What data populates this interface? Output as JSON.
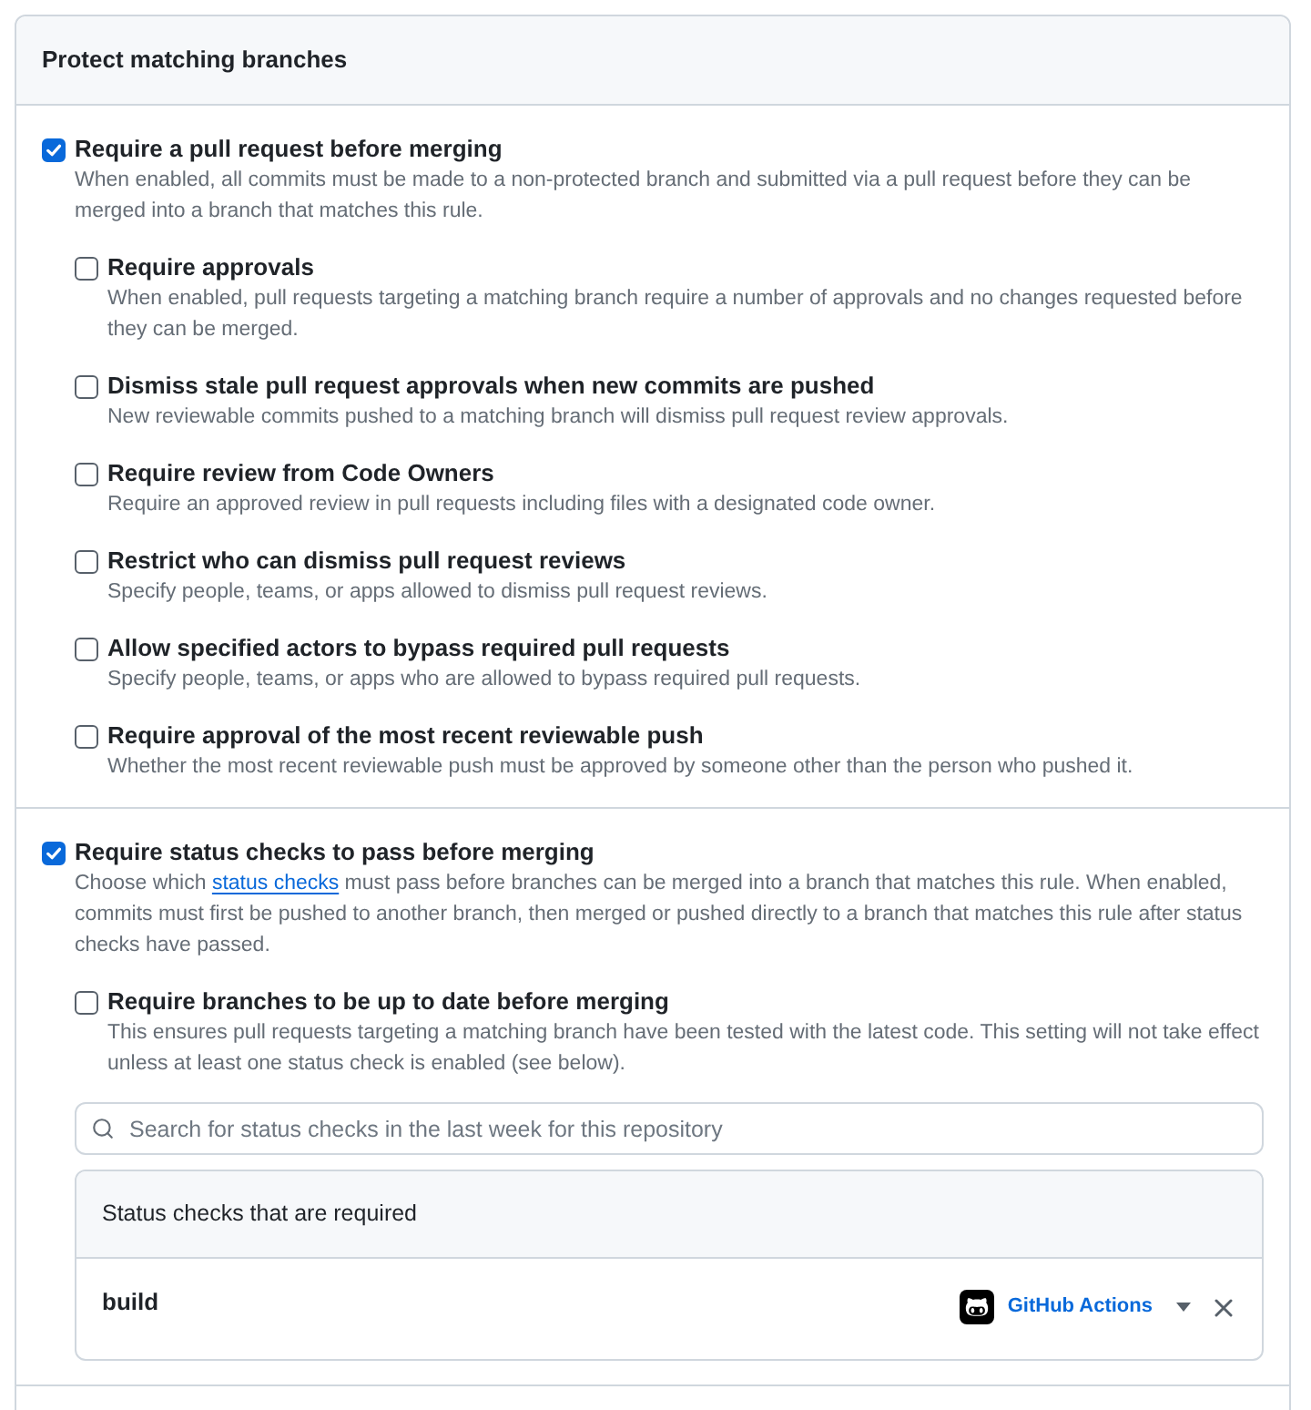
{
  "panel": {
    "title": "Protect matching branches"
  },
  "sections": [
    {
      "label": "Require a pull request before merging",
      "checked": true,
      "description": "When enabled, all commits must be made to a non-protected branch and submitted via a pull request before they can be merged into a branch that matches this rule.",
      "options": [
        {
          "label": "Require approvals",
          "checked": false,
          "description": "When enabled, pull requests targeting a matching branch require a number of approvals and no changes requested before they can be merged."
        },
        {
          "label": "Dismiss stale pull request approvals when new commits are pushed",
          "checked": false,
          "description": "New reviewable commits pushed to a matching branch will dismiss pull request review approvals."
        },
        {
          "label": "Require review from Code Owners",
          "checked": false,
          "description": "Require an approved review in pull requests including files with a designated code owner."
        },
        {
          "label": "Restrict who can dismiss pull request reviews",
          "checked": false,
          "description": "Specify people, teams, or apps allowed to dismiss pull request reviews."
        },
        {
          "label": "Allow specified actors to bypass required pull requests",
          "checked": false,
          "description": "Specify people, teams, or apps who are allowed to bypass required pull requests."
        },
        {
          "label": "Require approval of the most recent reviewable push",
          "checked": false,
          "description": "Whether the most recent reviewable push must be approved by someone other than the person who pushed it."
        }
      ]
    },
    {
      "label": "Require status checks to pass before merging",
      "checked": true,
      "description": [
        {
          "kind": "text",
          "text": "Choose which "
        },
        {
          "kind": "link",
          "text": "status checks"
        },
        {
          "kind": "text",
          "text": " must pass before branches can be merged into a branch that matches this rule. When enabled, commits must first be pushed to another branch, then merged or pushed directly to a branch that matches this rule after status checks have passed."
        }
      ],
      "options": [
        {
          "label": "Require branches to be up to date before merging",
          "checked": false,
          "description": "This ensures pull requests targeting a matching branch have been tested with the latest code. This setting will not take effect unless at least one status check is enabled (see below)."
        }
      ],
      "search": {
        "placeholder": "Search for status checks in the last week for this repository"
      },
      "required_checks": {
        "title": "Status checks that are required",
        "rows": [
          {
            "name": "build",
            "source": "GitHub Actions"
          }
        ]
      }
    }
  ]
}
